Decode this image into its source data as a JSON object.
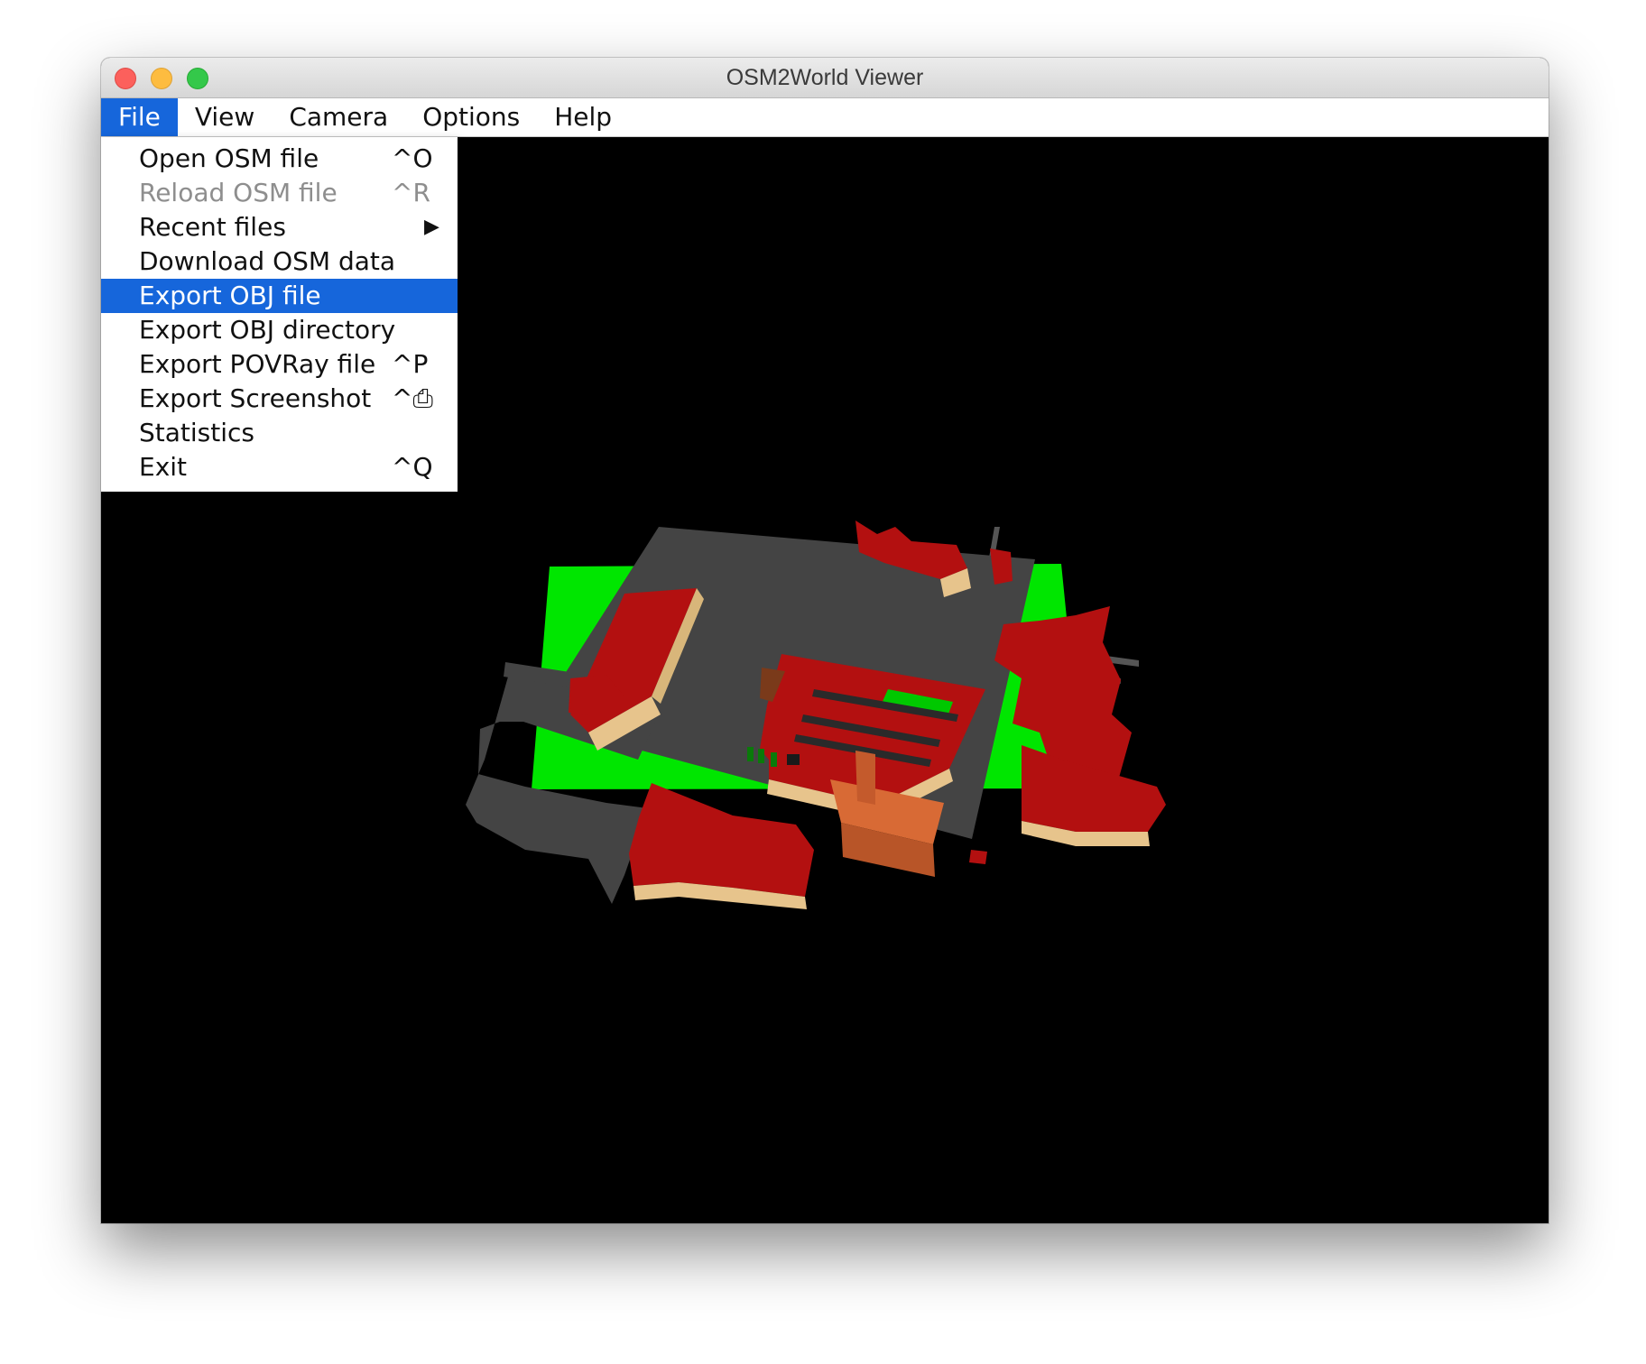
{
  "window": {
    "title": "OSM2World Viewer"
  },
  "menubar": {
    "items": [
      {
        "label": "File",
        "active": true
      },
      {
        "label": "View",
        "active": false
      },
      {
        "label": "Camera",
        "active": false
      },
      {
        "label": "Options",
        "active": false
      },
      {
        "label": "Help",
        "active": false
      }
    ]
  },
  "file_menu": {
    "items": [
      {
        "label": "Open OSM file",
        "shortcut": "^O",
        "enabled": true
      },
      {
        "label": "Reload OSM file",
        "shortcut": "^R",
        "enabled": false
      },
      {
        "label": "Recent files",
        "submenu_arrow": "▶",
        "enabled": true
      },
      {
        "label": "Download OSM data",
        "enabled": true
      },
      {
        "label": "Export OBJ file",
        "enabled": true,
        "highlighted": true
      },
      {
        "label": "Export OBJ directory",
        "enabled": true
      },
      {
        "label": "Export POVRay file",
        "shortcut": "^P",
        "enabled": true
      },
      {
        "label": "Export Screenshot",
        "shortcut": "^⎙",
        "enabled": true
      },
      {
        "label": "Statistics",
        "enabled": true
      },
      {
        "label": "Exit",
        "shortcut": "^Q",
        "enabled": true
      }
    ]
  },
  "colors": {
    "highlight": "#1666db",
    "background": "#000000",
    "ground": "#00e600",
    "road": "#444444",
    "roof": "#b31010",
    "wall": "#e7c48c",
    "church": "#d86a35"
  }
}
